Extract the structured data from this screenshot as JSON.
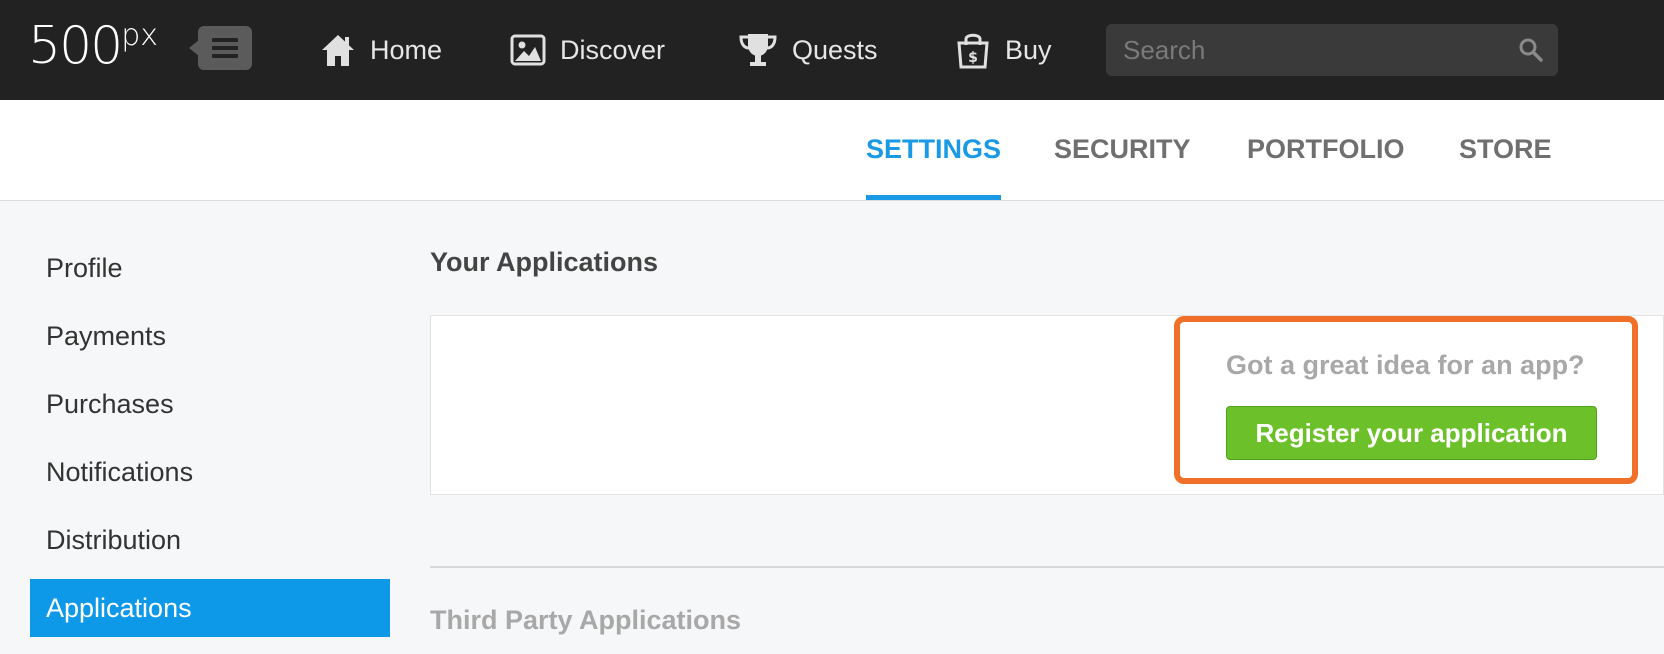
{
  "header": {
    "logo_main": "500",
    "logo_suffix": "px",
    "nav": [
      {
        "label": "Home",
        "icon": "home-icon"
      },
      {
        "label": "Discover",
        "icon": "image-icon"
      },
      {
        "label": "Quests",
        "icon": "trophy-icon"
      },
      {
        "label": "Buy",
        "icon": "shopping-bag-icon"
      }
    ],
    "search": {
      "placeholder": "Search",
      "value": ""
    }
  },
  "tabs": [
    {
      "label": "SETTINGS",
      "active": true
    },
    {
      "label": "SECURITY",
      "active": false
    },
    {
      "label": "PORTFOLIO",
      "active": false
    },
    {
      "label": "STORE",
      "active": false
    }
  ],
  "sidebar": {
    "items": [
      {
        "label": "Profile"
      },
      {
        "label": "Payments"
      },
      {
        "label": "Purchases"
      },
      {
        "label": "Notifications"
      },
      {
        "label": "Distribution"
      },
      {
        "label": "Applications",
        "active": true
      }
    ]
  },
  "main": {
    "your_apps_title": "Your Applications",
    "prompt": "Got a great idea for an app?",
    "register_label": "Register your application",
    "third_party_title": "Third Party Applications"
  },
  "colors": {
    "accent_blue": "#1a9ae4",
    "sidebar_active": "#0e99e8",
    "button_green": "#6cc12a",
    "highlight_orange": "#f0702a",
    "topbar": "#222222"
  }
}
